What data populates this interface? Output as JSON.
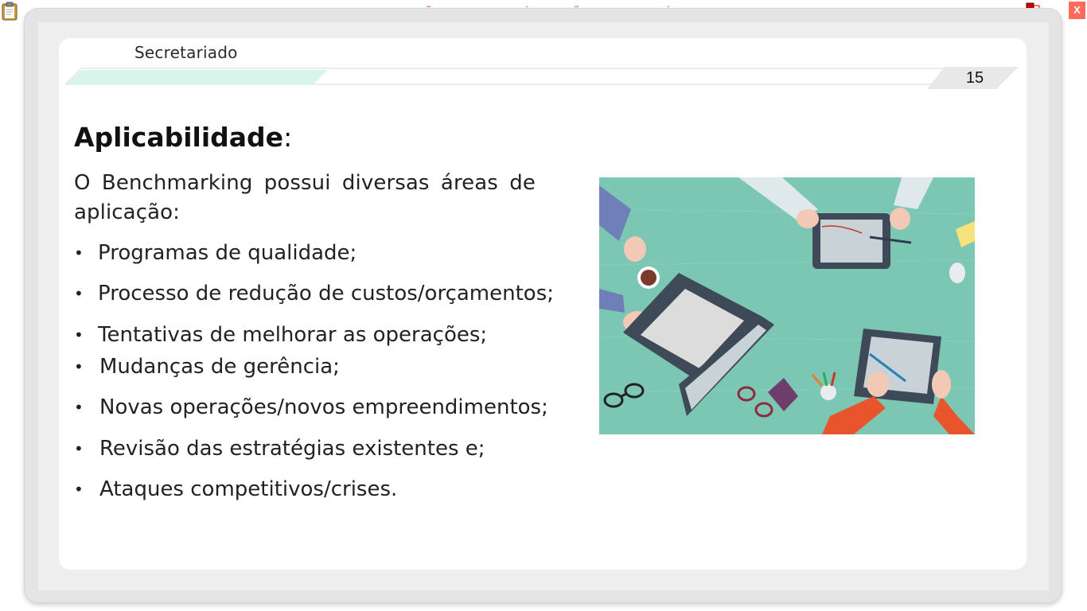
{
  "app": {
    "watermark": "VERSÃO PARA FUNCIONÁRIOS - NÃO COMERCIALIZÁVEL",
    "close_label": "X"
  },
  "slide": {
    "section": "Secretariado",
    "page_number": "15",
    "heading": "Aplicabilidade",
    "heading_suffix": ":",
    "intro": "O Benchmarking possui diversas áreas de aplicação:",
    "bullets": [
      "Programas de qualidade;",
      "Processo de redução de custos/orçamentos;",
      "Tentativas de melhorar as operações;",
      "Mudanças de gerência;",
      "Novas operações/novos empreendimentos;",
      "Revisão das estratégias existentes e;",
      "Ataques competitivos/crises."
    ]
  },
  "icons": {
    "top_left": "clipboard-icon",
    "top_right": "network-status-icon"
  },
  "colors": {
    "watermark": "#f06a6a",
    "close": "#ff6a5a",
    "header_accent": "#d8f5ec",
    "illustration_bg": "#7cc7b4"
  }
}
